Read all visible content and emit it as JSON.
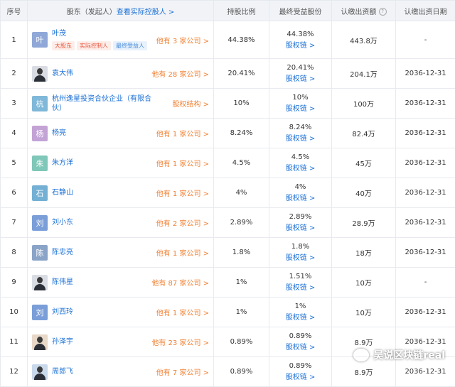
{
  "header": {
    "seq": "序号",
    "holder": "股东（发起人）",
    "holder_link": "查看实际控股人 >",
    "ratio": "持股比例",
    "final": "最终受益股份",
    "capital": "认缴出资额",
    "date": "认缴出资日期"
  },
  "rows": [
    {
      "seq": "1",
      "avatar": "叶",
      "avatar_color": "#8fa8d8",
      "name": "叶茂",
      "more": "他有 3 家公司 >",
      "ratio": "44.38%",
      "final": "44.38%",
      "chain": "股权链 >",
      "capital": "443.8万",
      "date": "-",
      "tags": [
        {
          "text": "大股东",
          "style": "red"
        },
        {
          "text": "实际控制人",
          "style": "red"
        },
        {
          "text": "最终受益人",
          "style": "blue"
        }
      ]
    },
    {
      "seq": "2",
      "avatar": "",
      "photo": "photo",
      "name": "袁大伟",
      "more": "他有 28 家公司 >",
      "ratio": "20.41%",
      "final": "20.41%",
      "chain": "股权链 >",
      "capital": "204.1万",
      "date": "2036-12-31"
    },
    {
      "seq": "3",
      "avatar": "杭",
      "avatar_color": "#7fb8d8",
      "name": "杭州逸星投资合伙企业（有限合伙）",
      "more": "股权结构 >",
      "ratio": "10%",
      "final": "10%",
      "chain": "股权链 >",
      "capital": "100万",
      "date": "2036-12-31"
    },
    {
      "seq": "4",
      "avatar": "杨",
      "avatar_color": "#c3a3d6",
      "name": "杨亮",
      "more": "他有 1 家公司 >",
      "ratio": "8.24%",
      "final": "8.24%",
      "chain": "股权链 >",
      "capital": "82.4万",
      "date": "2036-12-31"
    },
    {
      "seq": "5",
      "avatar": "朱",
      "avatar_color": "#7fc7b8",
      "name": "朱方洋",
      "more": "他有 1 家公司 >",
      "ratio": "4.5%",
      "final": "4.5%",
      "chain": "股权链 >",
      "capital": "45万",
      "date": "2036-12-31"
    },
    {
      "seq": "6",
      "avatar": "石",
      "avatar_color": "#74b0d4",
      "name": "石静山",
      "more": "他有 1 家公司 >",
      "ratio": "4%",
      "final": "4%",
      "chain": "股权链 >",
      "capital": "40万",
      "date": "2036-12-31"
    },
    {
      "seq": "7",
      "avatar": "刘",
      "avatar_color": "#7a9ed8",
      "name": "刘小东",
      "more": "他有 2 家公司 >",
      "ratio": "2.89%",
      "final": "2.89%",
      "chain": "股权链 >",
      "capital": "28.9万",
      "date": "2036-12-31"
    },
    {
      "seq": "8",
      "avatar": "陈",
      "avatar_color": "#8aa4c8",
      "name": "陈忠亮",
      "more": "他有 1 家公司 >",
      "ratio": "1.8%",
      "final": "1.8%",
      "chain": "股权链 >",
      "capital": "18万",
      "date": "2036-12-31"
    },
    {
      "seq": "9",
      "avatar": "",
      "photo": "photo",
      "name": "陈伟星",
      "more": "他有 87 家公司 >",
      "ratio": "1%",
      "final": "1.51%",
      "chain": "股权链 >",
      "capital": "10万",
      "date": "-"
    },
    {
      "seq": "10",
      "avatar": "刘",
      "avatar_color": "#7a9ed8",
      "name": "刘西玲",
      "more": "他有 1 家公司 >",
      "ratio": "1%",
      "final": "1%",
      "chain": "股权链 >",
      "capital": "10万",
      "date": "2036-12-31"
    },
    {
      "seq": "11",
      "avatar": "",
      "photo": "photo warm",
      "name": "孙泽宇",
      "more": "他有 23 家公司 >",
      "ratio": "0.89%",
      "final": "0.89%",
      "chain": "股权链 >",
      "capital": "8.9万",
      "date": "2036-12-31"
    },
    {
      "seq": "12",
      "avatar": "",
      "photo": "photo blue",
      "name": "周郎飞",
      "more": "他有 7 家公司 >",
      "ratio": "0.89%",
      "final": "0.89%",
      "chain": "股权链 >",
      "capital": "8.9万",
      "date": "2036-12-31"
    }
  ],
  "watermark": "吴说区块链real"
}
